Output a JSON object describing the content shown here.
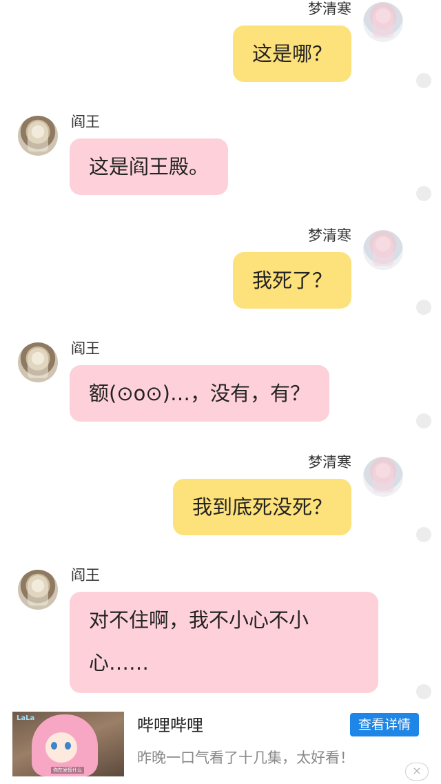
{
  "messages": [
    {
      "side": "right",
      "name": "梦清寒",
      "text": "这是哪？"
    },
    {
      "side": "left",
      "name": "阎王",
      "text": "这是阎王殿。"
    },
    {
      "side": "right",
      "name": "梦清寒",
      "text": "我死了？"
    },
    {
      "side": "left",
      "name": "阎王",
      "text": "额(⊙o⊙)…，没有，有？"
    },
    {
      "side": "right",
      "name": "梦清寒",
      "text": "我到底死没死？"
    },
    {
      "side": "left",
      "name": "阎王",
      "text": "对不住啊，我不小心不小心……"
    }
  ],
  "ad": {
    "title": "哔哩哔哩",
    "description": "昨晚一口气看了十几集，太好看！",
    "button_label": "查看详情",
    "close_icon": "×",
    "thumbnail_logo": "LaLa",
    "thumbnail_caption": "你在发慌什么"
  },
  "colors": {
    "outgoing_bubble": "#fde17a",
    "incoming_bubble": "#fdd0da",
    "ad_button": "#1e86e6"
  }
}
